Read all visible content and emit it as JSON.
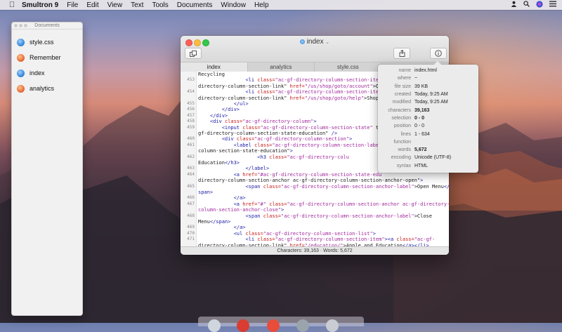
{
  "menubar": {
    "app_name": "Smultron 9",
    "items": [
      "File",
      "Edit",
      "View",
      "Text",
      "Tools",
      "Documents",
      "Window",
      "Help"
    ]
  },
  "documents_panel": {
    "title": "Documents",
    "items": [
      {
        "label": "style.css",
        "icon": "blue-document-icon"
      },
      {
        "label": "Remember",
        "icon": "orange-document-icon"
      },
      {
        "label": "index",
        "icon": "blue-document-icon"
      },
      {
        "label": "analytics",
        "icon": "orange-document-icon"
      }
    ]
  },
  "window": {
    "title": "index",
    "tabs": [
      "index",
      "analytics",
      "style.css",
      ""
    ],
    "active_tab": "index",
    "code_lines": [
      {
        "n": "",
        "html": "Recycling</a></li>"
      },
      {
        "n": "453",
        "html": "                <span class='tg'>&lt;li</span> <span class='at'>class=</span><span class='st'>\"ac-gf-directory-column-section-item\"</span>"
      },
      {
        "n": "",
        "html": "directory-column-section-link\" <span class='at'>href=</span><span class='st'>\"/us/shop/goto/account\"</span>&gt;Or"
      },
      {
        "n": "454",
        "html": "                <span class='tg'>&lt;li</span> <span class='at'>class=</span><span class='st'>\"ac-gf-directory-column-section-item\"</span>"
      },
      {
        "n": "",
        "html": "directory-column-section-link\" <span class='at'>href=</span><span class='st'>\"/us/shop/goto/help\"</span>&gt;Shopp"
      },
      {
        "n": "455",
        "html": "            <span class='tg'>&lt;/ul&gt;</span>"
      },
      {
        "n": "456",
        "html": "        <span class='tg'>&lt;/div&gt;</span>"
      },
      {
        "n": "457",
        "html": "    <span class='tg'>&lt;/div&gt;</span>"
      },
      {
        "n": "458",
        "html": "    <span class='tg'>&lt;div</span> <span class='at'>class=</span><span class='st'>\"ac-gf-directory-column\"</span><span class='tg'>&gt;</span>"
      },
      {
        "n": "459",
        "html": "        <span class='tg'>&lt;input</span> <span class='at'>class=</span><span class='st'>\"ac-gf-directory-column-section-state\"</span> ty"
      },
      {
        "n": "",
        "html": "gf-directory-column-section-state-education\" <span class='tg'>/&gt;</span>"
      },
      {
        "n": "460",
        "html": "        <span class='tg'>&lt;div</span> <span class='at'>class=</span><span class='st'>\"ac-gf-directory-column-section\"</span><span class='tg'>&gt;</span>"
      },
      {
        "n": "461",
        "html": "            <span class='tg'>&lt;label</span> <span class='at'>class=</span><span class='st'>\"ac-gf-directory-column-section-label</span>"
      },
      {
        "n": "",
        "html": "column-section-state-education\"<span class='tg'>&gt;</span>"
      },
      {
        "n": "462",
        "html": "                    <span class='tg'>&lt;h3</span> <span class='at'>class=</span><span class='st'>\"ac-gf-directory-colu</span>"
      },
      {
        "n": "",
        "html": "Education<span class='tg'>&lt;/h3&gt;</span>"
      },
      {
        "n": "463",
        "html": "                <span class='tg'>&lt;/label&gt;</span>"
      },
      {
        "n": "464",
        "html": "            <span class='tg'>&lt;a</span> <span class='at'>href=</span><span class='st'>\"#ac-gf-directory-column-section-state-edu</span>"
      },
      {
        "n": "",
        "html": "directory-column-section-anchor ac-gf-directory-column-section-anchor-open\"<span class='tg'>&gt;</span>"
      },
      {
        "n": "465",
        "html": "                <span class='tg'>&lt;span</span> <span class='at'>class=</span><span class='st'>\"ac-gf-directory-column-section-anchor-label\"</span>&gt;Open Menu<span class='tg'>&lt;/</span>"
      },
      {
        "n": "",
        "html": "<span class='tg'>span&gt;</span>"
      },
      {
        "n": "466",
        "html": "            <span class='tg'>&lt;/a&gt;</span>"
      },
      {
        "n": "467",
        "html": "            <span class='tg'>&lt;a</span> <span class='at'>href=</span><span class='st'>\"#\"</span> <span class='at'>class=</span><span class='st'>\"ac-gf-directory-column-section-anchor ac-gf-directory-</span>"
      },
      {
        "n": "",
        "html": "<span class='st'>column-section-anchor-close\"</span><span class='tg'>&gt;</span>"
      },
      {
        "n": "468",
        "html": "                <span class='tg'>&lt;span</span> <span class='at'>class=</span><span class='st'>\"ac-gf-directory-column-section-anchor-label\"</span>&gt;Close"
      },
      {
        "n": "",
        "html": "Menu<span class='tg'>&lt;/span&gt;</span>"
      },
      {
        "n": "469",
        "html": "            <span class='tg'>&lt;/a&gt;</span>"
      },
      {
        "n": "470",
        "html": "            <span class='tg'>&lt;ul</span> <span class='at'>class=</span><span class='st'>\"ac-gf-directory-column-section-list\"</span><span class='tg'>&gt;</span>"
      },
      {
        "n": "471",
        "html": "                <span class='tg'>&lt;li</span> <span class='at'>class=</span><span class='st'>\"ac-gf-directory-column-section-item\"</span><span class='tg'>&gt;&lt;a</span> <span class='at'>class=</span><span class='st'>\"ac-gf-</span>"
      },
      {
        "n": "",
        "html": "directory-column-section-link\" <span class='at'>href=</span><span class='st'>\"/education/\"</span>&gt;Apple and Education<span class='tg'>&lt;/a&gt;&lt;/li&gt;</span>"
      },
      {
        "n": "472",
        "html": "                <span class='tg'>&lt;li</span> <span class='at'>class=</span><span class='st'>\"ac-gf-directory-column-section-item\"</span><span class='tg'>&gt;&lt;a</span> <span class='at'>class=</span><span class='st'>\"ac-gf-</span>"
      }
    ],
    "status": "Characters: 39,163 · Words: 5,672"
  },
  "inspector": {
    "rows": [
      {
        "key": "name",
        "value": "index.html",
        "bold": false
      },
      {
        "key": "where",
        "value": "~",
        "bold": false
      },
      {
        "key": "file size",
        "value": "39 KB",
        "bold": false
      },
      {
        "key": "created",
        "value": "Today, 9:25 AM",
        "bold": false
      },
      {
        "key": "modified",
        "value": "Today, 9:25 AM",
        "bold": false
      },
      {
        "key": "characters",
        "value": "39,163",
        "bold": true
      },
      {
        "key": "selection",
        "value": "0 - 0",
        "bold": true
      },
      {
        "key": "position",
        "value": "0 - 0",
        "bold": false
      },
      {
        "key": "lines",
        "value": "1 - 634",
        "bold": false
      },
      {
        "key": "function",
        "value": "",
        "bold": false
      },
      {
        "key": "words",
        "value": "5,672",
        "bold": true
      },
      {
        "key": "encoding",
        "value": "Unicode (UTF-8)",
        "bold": false
      },
      {
        "key": "syntax",
        "value": "HTML",
        "bold": false
      }
    ]
  },
  "colors": {
    "close": "#fc605b",
    "minimize": "#fdbc40",
    "zoom": "#34c84a",
    "tag": "#1a1aa6",
    "attribute": "#c41a16",
    "string": "#a0289c"
  }
}
